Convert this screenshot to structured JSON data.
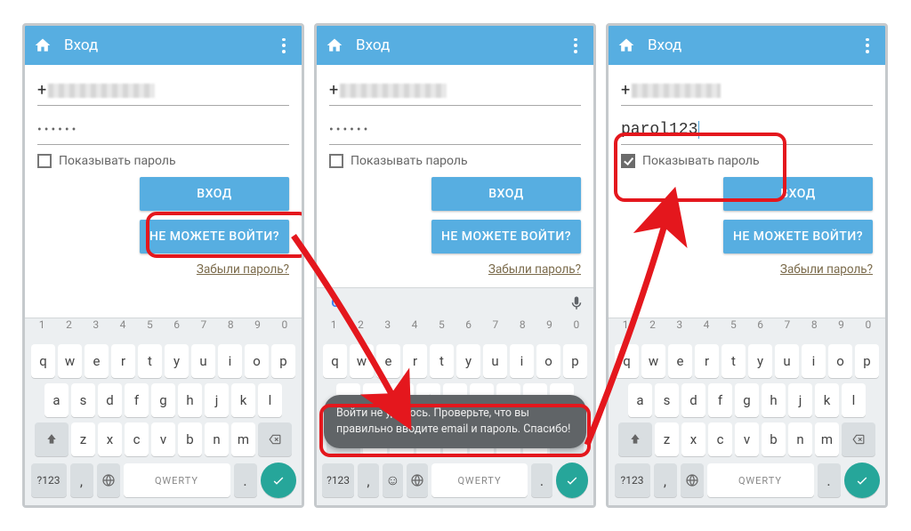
{
  "appbar": {
    "title": "Вход"
  },
  "form": {
    "login_prefix": "+",
    "password_masked": "••••••",
    "password_visible": "parol123",
    "show_password_label": "Показывать пароль",
    "login_button": "ВХОД",
    "cant_login_button": "НЕ МОЖЕТЕ ВОЙТИ?",
    "forgot_link": "Забыли пароль?"
  },
  "toast": {
    "error": "Войти не удалось. Проверьте, что вы правильно вводите email и пароль. Спасибо!"
  },
  "keyboard": {
    "numbers": [
      "1",
      "2",
      "3",
      "4",
      "5",
      "6",
      "7",
      "8",
      "9",
      "0"
    ],
    "row1": [
      "q",
      "w",
      "e",
      "r",
      "t",
      "y",
      "u",
      "i",
      "o",
      "p"
    ],
    "row2": [
      "a",
      "s",
      "d",
      "f",
      "g",
      "h",
      "j",
      "k",
      "l"
    ],
    "row3": [
      "z",
      "x",
      "c",
      "v",
      "b",
      "n",
      "m"
    ],
    "sym": "?123",
    "space": "QWERTY",
    "comma": ",",
    "dot": "."
  },
  "colors": {
    "accent": "#57aee1",
    "highlight": "#e4171d",
    "enter": "#26a69a"
  }
}
